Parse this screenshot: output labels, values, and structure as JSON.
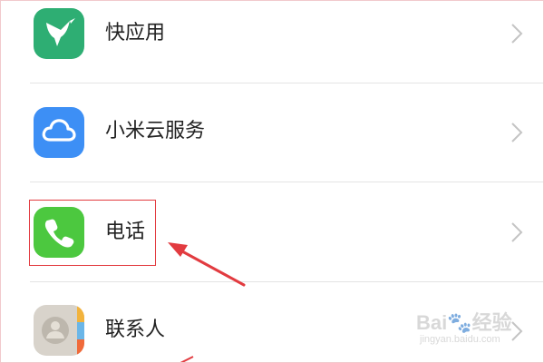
{
  "settings_list": {
    "items": [
      {
        "label": "快应用",
        "icon": "hummingbird-icon",
        "color": "#2eae73"
      },
      {
        "label": "小米云服务",
        "icon": "cloud-icon",
        "color": "#3d8ff5"
      },
      {
        "label": "电话",
        "icon": "phone-icon",
        "color": "#4cc83f"
      },
      {
        "label": "联系人",
        "icon": "contacts-icon",
        "color": "#d8d3cb"
      }
    ]
  },
  "annotation": {
    "highlight_color": "#e23b40",
    "arrow_color": "#e23b40"
  },
  "watermark": {
    "brand": "Bai🐾经验",
    "url": "jingyan.baidu.com"
  }
}
